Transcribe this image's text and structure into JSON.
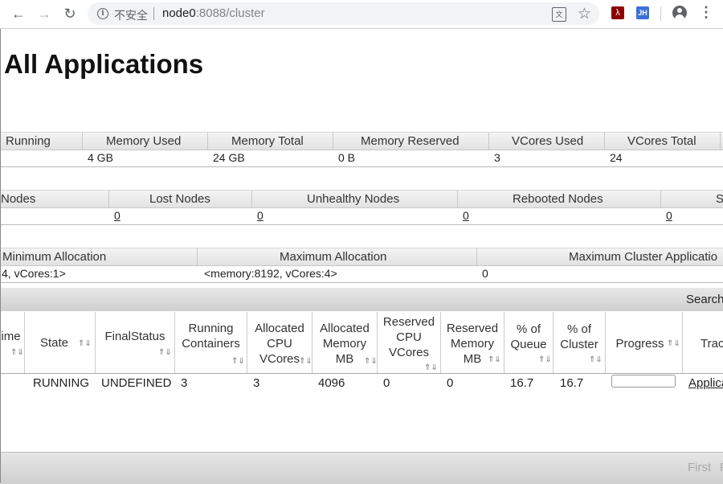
{
  "browser": {
    "security_label": "不安全",
    "url_host": "node0",
    "url_rest": ":8088/cluster"
  },
  "page_title": "All Applications",
  "cluster_metrics": {
    "headers": [
      "Running",
      "Memory Used",
      "Memory Total",
      "Memory Reserved",
      "VCores Used",
      "VCores Total"
    ],
    "values": [
      "",
      "4 GB",
      "24 GB",
      "0 B",
      "3",
      "24"
    ]
  },
  "node_metrics": {
    "headers": [
      "Nodes",
      "Lost Nodes",
      "Unhealthy Nodes",
      "Rebooted Nodes",
      "S"
    ],
    "values": [
      "0",
      "0",
      "0",
      "0"
    ]
  },
  "scheduler_metrics": {
    "headers": [
      "Minimum Allocation",
      "Maximum Allocation",
      "Maximum Cluster Applicatio"
    ],
    "values": [
      "4, vCores:1>",
      "<memory:8192, vCores:4>",
      "0"
    ]
  },
  "apps": {
    "search_label": "Search",
    "columns": [
      {
        "label": "ime"
      },
      {
        "label": "State"
      },
      {
        "label": "FinalStatus"
      },
      {
        "label": "Running Containers"
      },
      {
        "label": "Allocated CPU VCores"
      },
      {
        "label": "Allocated Memory MB"
      },
      {
        "label": "Reserved CPU VCores"
      },
      {
        "label": "Reserved Memory MB"
      },
      {
        "label": "% of Queue"
      },
      {
        "label": "% of Cluster"
      },
      {
        "label": "Progress"
      },
      {
        "label": "Trac"
      }
    ],
    "row": {
      "state": "RUNNING",
      "final_status": "UNDEFINED",
      "running_containers": "3",
      "allocated_vcores": "3",
      "allocated_memory": "4096",
      "reserved_vcores": "0",
      "reserved_memory": "0",
      "pct_queue": "16.7",
      "pct_cluster": "16.7",
      "progress": 0.0,
      "tracking": "Applica"
    },
    "pagination": {
      "first": "First",
      "prev": "P"
    }
  }
}
